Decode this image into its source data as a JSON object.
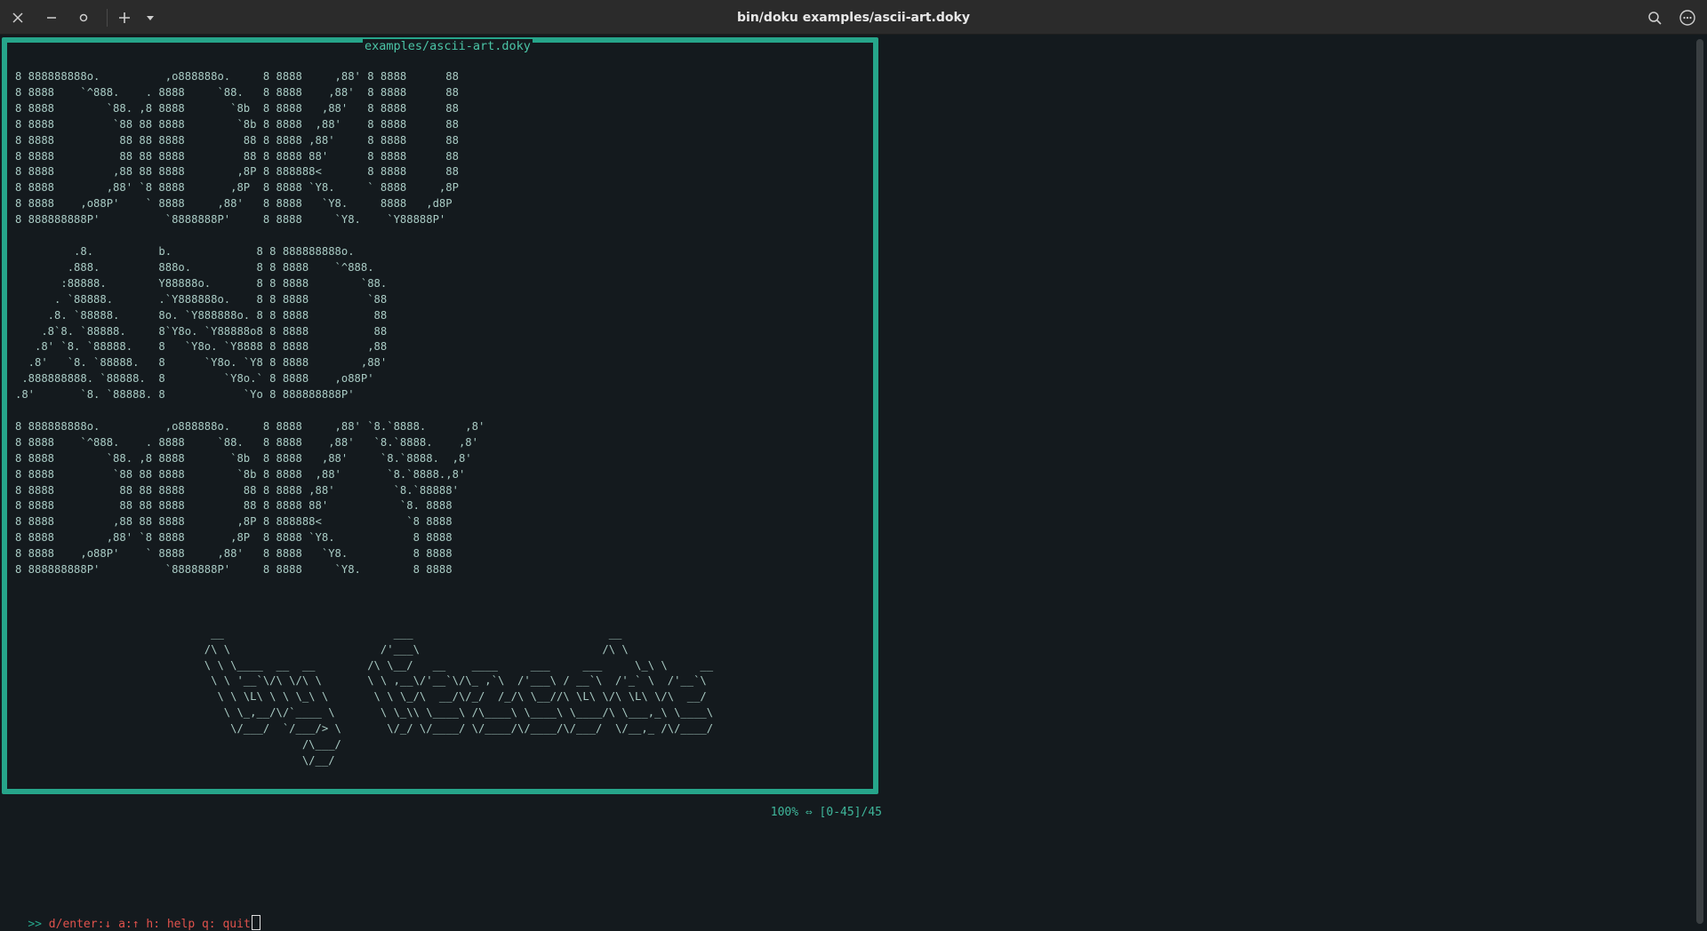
{
  "window": {
    "title": "bin/doku examples/ascii-art.doky",
    "icons": {
      "close": "close-icon",
      "minimize": "minimize-icon",
      "maximize": "maximize-icon",
      "new_tab": "plus-icon",
      "dropdown": "chevron-down-icon",
      "search": "search-icon",
      "menu": "more-icon"
    }
  },
  "viewer": {
    "file_name": "examples/ascii-art.doky",
    "ascii_lines": [
      "8 888888888o.          ,o888888o.     8 8888     ,88' 8 8888      88",
      "8 8888    `^888.    . 8888     `88.   8 8888    ,88'  8 8888      88",
      "8 8888        `88. ,8 8888       `8b  8 8888   ,88'   8 8888      88",
      "8 8888         `88 88 8888        `8b 8 8888  ,88'    8 8888      88",
      "8 8888          88 88 8888         88 8 8888 ,88'     8 8888      88",
      "8 8888          88 88 8888         88 8 8888 88'      8 8888      88",
      "8 8888         ,88 88 8888        ,8P 8 888888<       8 8888      88",
      "8 8888        ,88' `8 8888       ,8P  8 8888 `Y8.     ` 8888     ,8P",
      "8 8888    ,o88P'    ` 8888     ,88'   8 8888   `Y8.     8888   ,d8P",
      "8 888888888P'          `8888888P'     8 8888     `Y8.    `Y88888P'",
      "",
      "         .8.          b.             8 8 888888888o.",
      "        .888.         888o.          8 8 8888    `^888.",
      "       :88888.        Y88888o.       8 8 8888        `88.",
      "      . `88888.       .`Y888888o.    8 8 8888         `88",
      "     .8. `88888.      8o. `Y888888o. 8 8 8888          88",
      "    .8`8. `88888.     8`Y8o. `Y88888o8 8 8888          88",
      "   .8' `8. `88888.    8   `Y8o. `Y8888 8 8888         ,88",
      "  .8'   `8. `88888.   8      `Y8o. `Y8 8 8888        ,88'",
      " .888888888. `88888.  8         `Y8o.` 8 8888    ,o88P'",
      ".8'       `8. `88888. 8            `Yo 8 888888888P'",
      "",
      "8 888888888o.          ,o888888o.     8 8888     ,88' `8.`8888.      ,8'",
      "8 8888    `^888.    . 8888     `88.   8 8888    ,88'   `8.`8888.    ,8'",
      "8 8888        `88. ,8 8888       `8b  8 8888   ,88'     `8.`8888.  ,8'",
      "8 8888         `88 88 8888        `8b 8 8888  ,88'       `8.`8888.,8'",
      "8 8888          88 88 8888         88 8 8888 ,88'         `8.`88888'",
      "8 8888          88 88 8888         88 8 8888 88'           `8. 8888",
      "8 8888         ,88 88 8888        ,8P 8 888888<             `8 8888",
      "8 8888        ,88' `8 8888       ,8P  8 8888 `Y8.            8 8888",
      "8 8888    ,o88P'    ` 8888     ,88'   8 8888   `Y8.          8 8888",
      "8 888888888P'          `8888888P'     8 8888     `Y8.        8 8888",
      "",
      "",
      "",
      "                              __                          ___                              __",
      "                             /\\ \\                       /'___\\                            /\\ \\",
      "                             \\ \\ \\____  __  __        /\\ \\__/   __    ____     ___     ___     \\_\\ \\     __",
      "                              \\ \\ '__`\\/\\ \\/\\ \\       \\ \\ ,__\\/'__`\\/\\_ ,`\\  /'___\\ / __`\\  /'_` \\  /'__`\\",
      "                               \\ \\ \\L\\ \\ \\ \\_\\ \\       \\ \\ \\_/\\  __/\\/_/  /_/\\ \\__//\\ \\L\\ \\/\\ \\L\\ \\/\\  __/",
      "                                \\ \\_,__/\\/`____ \\       \\ \\_\\\\ \\____\\ /\\____\\ \\____\\ \\____/\\ \\___,_\\ \\____\\",
      "                                 \\/___/  `/___/> \\       \\/_/ \\/____/ \\/____/\\/____/\\/___/  \\/__,_ /\\/____/",
      "                                            /\\___/",
      "                                            \\/__/"
    ]
  },
  "status": {
    "position": "100% ⇔ [0-45]/45"
  },
  "prompt": {
    "prefix": ">>",
    "text": "d/enter:↓ a:↑ h: help q: quit"
  }
}
